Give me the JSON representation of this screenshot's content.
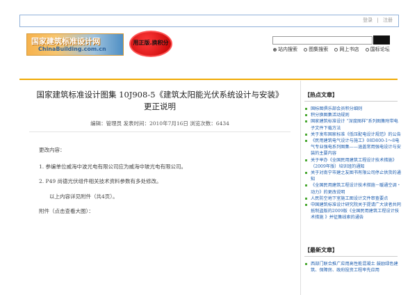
{
  "header": {
    "login_label": "登录",
    "separator": "|",
    "register_label": "注册"
  },
  "logo": {
    "text_cn": "国家建筑标准设计网",
    "text_en": "ChinaBuilding.com.cn",
    "icon": "building-logo-icon"
  },
  "badge": {
    "text": "用正版.换积分",
    "color": "#d40000"
  },
  "search": {
    "value": "",
    "placeholder": "",
    "options": [
      {
        "label": "站内搜索",
        "selected": true
      },
      {
        "label": "图集搜索",
        "selected": false
      },
      {
        "label": "网上书店",
        "selected": false
      },
      {
        "label": "国标论坛",
        "selected": false
      }
    ]
  },
  "article": {
    "title_line1": "国家建筑标准设计图集 10J908-5《建筑太阳能光伏系统设计与安装》",
    "title_line2": "更正说明",
    "meta": "编辑：管理员    发表时间：2010年7月16日    浏览次数：6434",
    "paragraphs": [
      "更改内容：",
      "1.  参编单位威海中波光电有限公司应为威海中玻光电有限公司。",
      "2.  P49 尚德光伏组件相关技术资料参数有多处修改。",
      "以上内容详见附件（共4页）。",
      "附件（点击查看大图）："
    ]
  },
  "sidebar": {
    "hot_title": "【热点文章】",
    "hot_items": [
      "国标图俱乐部会员积分细则",
      "积分换图集活动规则",
      "国家建筑标准设计 “深度图样”系列图集附带电子文件下载方法",
      "关于发布国家标准《低压配电设计规范》的公告",
      "《民用建筑电气设计与施工》08D800-1～8电气专业强电系列图集——涵盖常用强电设计与安装的主要内容",
      "关于举办《全国民用建筑工程设计技术措施》（2009年版）培训班的通知",
      "关于对南宁市建之友图书有限公司停止供货的通知",
      "《全国民用建筑工程设计技术措施－暖通空调・动力》的更改说明",
      "人民防空地下室施工图设计文件审查要点",
      "中国建筑标准设计研究院关于提请广大读者共同抵制盗版的2009版《全国民用建筑工程设计技术措施 》并征集线索的通告"
    ],
    "latest_title": "【最新文章】",
    "latest_items": [
      "西部门联合推广应用高性能混凝土 鼓励绿色建筑、保障房、政府投资工程率先应用"
    ]
  },
  "colors": {
    "accent_line": "#f0a900",
    "link": "#1f5fb0",
    "bullet": "#4aa832",
    "frame_border": "#8fb0d8"
  }
}
